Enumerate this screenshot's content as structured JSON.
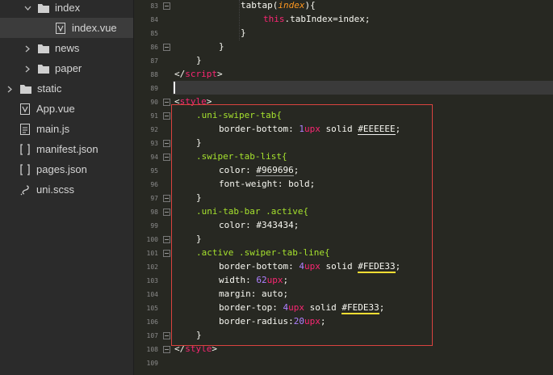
{
  "sidebar": {
    "items": [
      {
        "label": "index",
        "depth": 1,
        "type": "folder",
        "expanded": true
      },
      {
        "label": "index.vue",
        "depth": 2,
        "type": "vue",
        "selected": true
      },
      {
        "label": "news",
        "depth": 1,
        "type": "folder",
        "expanded": false
      },
      {
        "label": "paper",
        "depth": 1,
        "type": "folder",
        "expanded": false
      },
      {
        "label": "static",
        "depth": 0,
        "type": "folder",
        "expanded": false
      },
      {
        "label": "App.vue",
        "depth": 0,
        "type": "vue"
      },
      {
        "label": "main.js",
        "depth": 0,
        "type": "js"
      },
      {
        "label": "manifest.json",
        "depth": 0,
        "type": "json"
      },
      {
        "label": "pages.json",
        "depth": 0,
        "type": "json"
      },
      {
        "label": "uni.scss",
        "depth": 0,
        "type": "scss"
      }
    ]
  },
  "editor": {
    "line_numbers": [
      "83",
      "84",
      "85",
      "86",
      "87",
      "88",
      "89",
      "90",
      "91",
      "92",
      "93",
      "94",
      "95",
      "96",
      "97",
      "98",
      "99",
      "100",
      "101",
      "102",
      "103",
      "104",
      "105",
      "106",
      "107",
      "108",
      "109"
    ],
    "lines": {
      "l83_a": "tabtap(",
      "l83_b": "index",
      "l83_c": "){",
      "l84_a": "this",
      "l84_b": ".tabIndex=index;",
      "l85": "}",
      "l86": "}",
      "l87": "}",
      "l88_a": "</",
      "l88_b": "script",
      "l88_c": ">",
      "l90_a": "<",
      "l90_b": "style",
      "l90_c": ">",
      "l91": ".uni-swiper-tab{",
      "l92_a": "border-bottom: ",
      "l92_b": "1",
      "l92_c": "upx",
      "l92_d": " solid ",
      "l92_e": "#EEEEEE",
      "l92_f": ";",
      "l93": "}",
      "l94": ".swiper-tab-list{",
      "l95_a": "color: ",
      "l95_b": "#969696",
      "l95_c": ";",
      "l96_a": "font-weight: ",
      "l96_b": "bold",
      "l96_c": ";",
      "l97": "}",
      "l98": ".uni-tab-bar .active{",
      "l99_a": "color: ",
      "l99_b": "#343434",
      "l99_c": ";",
      "l100": "}",
      "l101": ".active .swiper-tab-line{",
      "l102_a": "border-bottom: ",
      "l102_b": "4",
      "l102_c": "upx",
      "l102_d": " solid ",
      "l102_e": "#FEDE33",
      "l102_f": ";",
      "l103_a": "width: ",
      "l103_b": "62",
      "l103_c": "upx",
      "l103_d": ";",
      "l104_a": "margin: ",
      "l104_b": "auto",
      "l104_c": ";",
      "l105_a": "border-top: ",
      "l105_b": "4",
      "l105_c": "upx",
      "l105_d": " solid ",
      "l105_e": "#FEDE33",
      "l105_f": ";",
      "l106_a": "border-radius:",
      "l106_b": "20",
      "l106_c": "upx",
      "l106_d": ";",
      "l107": "}",
      "l108_a": "</",
      "l108_b": "style",
      "l108_c": ">"
    }
  },
  "colors": {
    "background": "#272822",
    "sidebar": "#2b2b2b",
    "keyword": "#f92672",
    "selector": "#a6e22e",
    "number": "#ae81ff",
    "highlight_box": "#d9433f"
  },
  "icons": {
    "folder": "folder-icon",
    "vue": "vue-file-icon",
    "js": "js-file-icon",
    "json": "json-file-icon",
    "scss": "scss-file-icon"
  }
}
